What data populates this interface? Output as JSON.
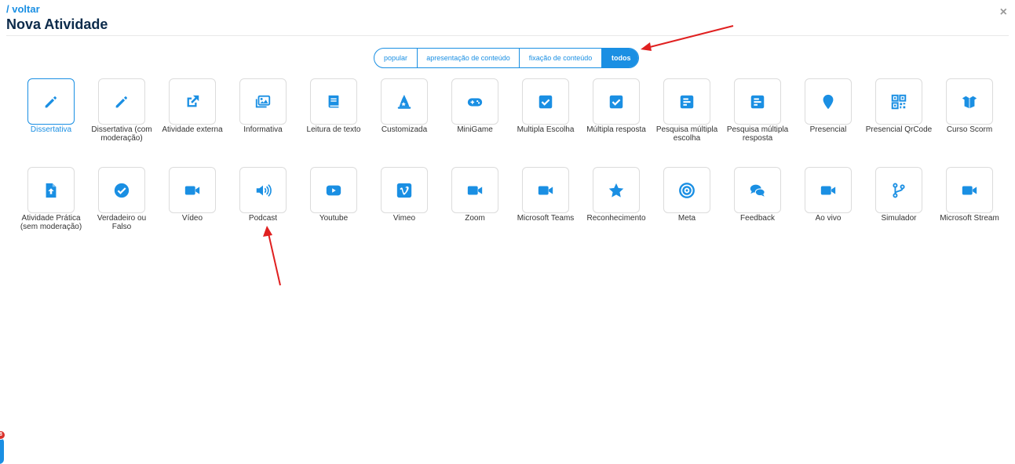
{
  "header": {
    "back_label": "/ voltar",
    "title": "Nova Atividade",
    "close_symbol": "×"
  },
  "tabs": [
    {
      "label": "popular",
      "active": false
    },
    {
      "label": "apresentação de conteúdo",
      "active": false
    },
    {
      "label": "fixação de conteúdo",
      "active": false
    },
    {
      "label": "todos",
      "active": true
    }
  ],
  "colors": {
    "accent": "#1a8fe3",
    "title": "#0b2a4a",
    "arrow": "#e02020",
    "badge": "#d9312b"
  },
  "activities_row1": [
    {
      "label": "Dissertativa",
      "icon": "pencil-icon",
      "selected": true
    },
    {
      "label": "Dissertativa (com moderação)",
      "icon": "pencil-icon"
    },
    {
      "label": "Atividade externa",
      "icon": "external-link-icon"
    },
    {
      "label": "Informativa",
      "icon": "images-icon"
    },
    {
      "label": "Leitura de texto",
      "icon": "book-icon"
    },
    {
      "label": "Customizada",
      "icon": "wizard-hat-icon"
    },
    {
      "label": "MiniGame",
      "icon": "gamepad-icon"
    },
    {
      "label": "Multipla Escolha",
      "icon": "check-square-icon"
    },
    {
      "label": "Múltipla resposta",
      "icon": "check-square-icon"
    },
    {
      "label": "Pesquisa múltipla escolha",
      "icon": "poll-icon"
    },
    {
      "label": "Pesquisa múltipla resposta",
      "icon": "poll-icon"
    },
    {
      "label": "Presencial",
      "icon": "map-marker-icon"
    },
    {
      "label": "Presencial QrCode",
      "icon": "qrcode-icon"
    },
    {
      "label": "Curso Scorm",
      "icon": "box-open-icon"
    }
  ],
  "activities_row2": [
    {
      "label": "Atividade Prática (sem moderação)",
      "icon": "file-upload-icon"
    },
    {
      "label": "Verdadeiro ou Falso",
      "icon": "check-circle-icon"
    },
    {
      "label": "Vídeo",
      "icon": "video-icon"
    },
    {
      "label": "Podcast",
      "icon": "volume-icon"
    },
    {
      "label": "Youtube",
      "icon": "youtube-icon"
    },
    {
      "label": "Vimeo",
      "icon": "vimeo-icon"
    },
    {
      "label": "Zoom",
      "icon": "video-icon"
    },
    {
      "label": "Microsoft Teams",
      "icon": "video-icon"
    },
    {
      "label": "Reconhecimento",
      "icon": "star-icon"
    },
    {
      "label": "Meta",
      "icon": "bullseye-icon"
    },
    {
      "label": "Feedback",
      "icon": "comments-icon"
    },
    {
      "label": "Ao vivo",
      "icon": "video-icon"
    },
    {
      "label": "Simulador",
      "icon": "code-branch-icon"
    },
    {
      "label": "Microsoft Stream",
      "icon": "video-icon"
    }
  ],
  "notification": {
    "count": "8"
  }
}
